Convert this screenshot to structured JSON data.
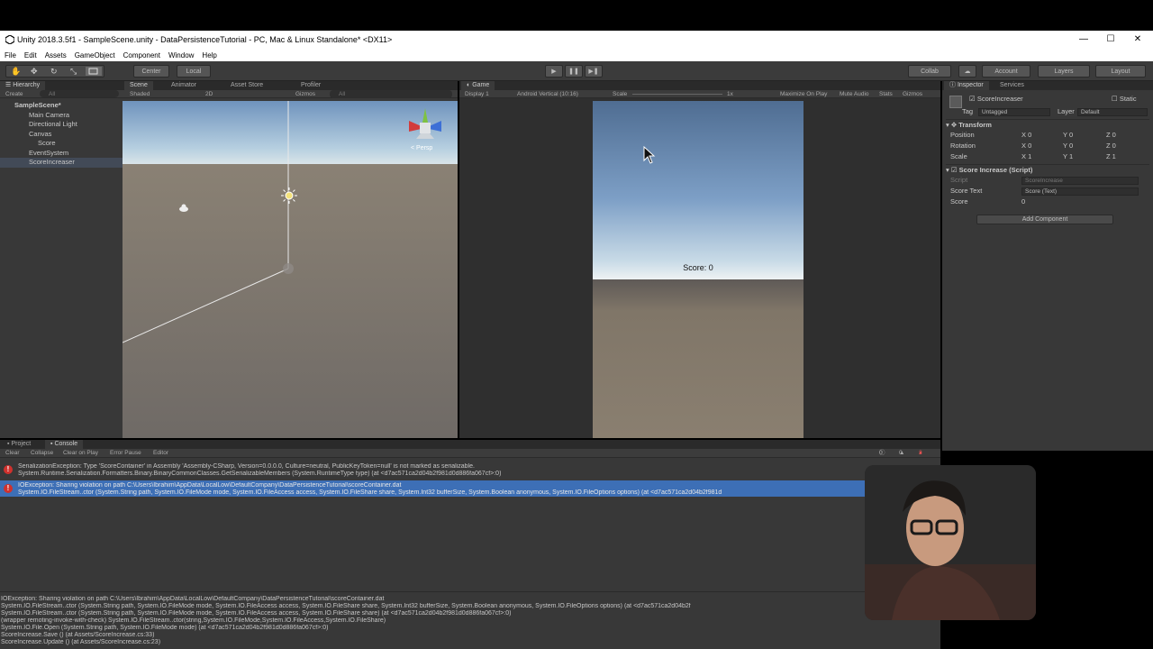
{
  "window": {
    "title": "Unity 2018.3.5f1 - SampleScene.unity - DataPersistenceTutorial - PC, Mac & Linux Standalone* <DX11>",
    "minimize": "—",
    "maximize": "☐",
    "close": "✕"
  },
  "menu": [
    "File",
    "Edit",
    "Assets",
    "GameObject",
    "Component",
    "Window",
    "Help"
  ],
  "toolbar": {
    "pivot_center": "Center",
    "pivot_local": "Local",
    "collab": "Collab",
    "account": "Account",
    "layers": "Layers",
    "layout": "Layout",
    "play": "▶",
    "pause": "❚❚",
    "step": "▶❚"
  },
  "hierarchy": {
    "tab": "Hierarchy",
    "create": "Create",
    "search_placeholder": "All",
    "scene": "SampleScene*",
    "items": [
      {
        "label": "Main Camera"
      },
      {
        "label": "Directional Light"
      },
      {
        "label": "Canvas"
      },
      {
        "label": "Score"
      },
      {
        "label": "EventSystem"
      },
      {
        "label": "ScoreIncreaser"
      }
    ]
  },
  "scene_view": {
    "tabs": [
      "Scene",
      "Animator",
      "Asset Store",
      "Profiler"
    ],
    "shading": "Shaded",
    "mode_2d": "2D",
    "gizmos": "Gizmos",
    "search_placeholder": "All",
    "persp": "< Persp"
  },
  "game_view": {
    "tab": "Game",
    "display": "Display 1",
    "aspect": "Android Vertical (10:16)",
    "scale_label": "Scale",
    "scale_value": "1x",
    "maximize": "Maximize On Play",
    "mute": "Mute Audio",
    "stats": "Stats",
    "gizmos": "Gizmos",
    "score_text": "Score: 0"
  },
  "inspector": {
    "tabs": [
      "Inspector",
      "Services"
    ],
    "object_name": "ScoreIncreaser",
    "static": "Static",
    "tag_label": "Tag",
    "tag_value": "Untagged",
    "layer_label": "Layer",
    "layer_value": "Default",
    "transform": {
      "title": "Transform",
      "rows": [
        {
          "label": "Position",
          "x": "0",
          "y": "0",
          "z": "0"
        },
        {
          "label": "Rotation",
          "x": "0",
          "y": "0",
          "z": "0"
        },
        {
          "label": "Scale",
          "x": "1",
          "y": "1",
          "z": "1"
        }
      ]
    },
    "script_component": {
      "title": "Score Increase (Script)",
      "script_label": "Script",
      "script_value": "ScoreIncrease",
      "score_text_label": "Score Text",
      "score_text_value": "Score (Text)",
      "score_label": "Score",
      "score_value": "0"
    },
    "add_component": "Add Component"
  },
  "console": {
    "tabs": [
      "Project",
      "Console"
    ],
    "buttons": [
      "Clear",
      "Collapse",
      "Clear on Play",
      "Error Pause",
      "Editor"
    ],
    "count_info": "0",
    "count_warn": "0",
    "count_error": "2",
    "entries": [
      {
        "line1": "SerializationException: Type 'ScoreContainer' in Assembly 'Assembly-CSharp, Version=0.0.0.0, Culture=neutral, PublicKeyToken=null' is not marked as serializable.",
        "line2": "System.Runtime.Serialization.Formatters.Binary.BinaryCommonClasses.GetSerializableMembers (System.RuntimeType type) (at <d7ac571ca2d04b2f981d0d886fa067cf>:0)",
        "selected": false
      },
      {
        "line1": "IOException: Sharing violation on path C:\\Users\\Ibrahim\\AppData\\LocalLow\\DefaultCompany\\DataPersistenceTutorial\\scoreContainer.dat",
        "line2": "System.IO.FileStream..ctor (System.String path, System.IO.FileMode mode, System.IO.FileAccess access, System.IO.FileShare share, System.Int32 bufferSize, System.Boolean anonymous, System.IO.FileOptions options) (at <d7ac571ca2d04b2f981d",
        "selected": true
      }
    ],
    "detail": [
      "IOException: Sharing violation on path C:\\Users\\Ibrahim\\AppData\\LocalLow\\DefaultCompany\\DataPersistenceTutorial\\scoreContainer.dat",
      "System.IO.FileStream..ctor (System.String path, System.IO.FileMode mode, System.IO.FileAccess access, System.IO.FileShare share, System.Int32 bufferSize, System.Boolean anonymous, System.IO.FileOptions options) (at <d7ac571ca2d04b2f",
      "System.IO.FileStream..ctor (System.String path, System.IO.FileMode mode, System.IO.FileAccess access, System.IO.FileShare share) (at <d7ac571ca2d04b2f981d0d886fa067cf>:0)",
      "(wrapper remoting-invoke-with-check) System.IO.FileStream..ctor(string,System.IO.FileMode,System.IO.FileAccess,System.IO.FileShare)",
      "System.IO.File.Open (System.String path, System.IO.FileMode mode) (at <d7ac571ca2d04b2f981d0d886fa067cf>:0)",
      "ScoreIncrease.Save () (at Assets/ScoreIncrease.cs:33)",
      "ScoreIncrease.Update () (at Assets/ScoreIncrease.cs:23)"
    ]
  },
  "colors": {
    "editor_bg": "#383838",
    "error_red": "#d0312d",
    "selection_blue": "#3d6fb6"
  }
}
